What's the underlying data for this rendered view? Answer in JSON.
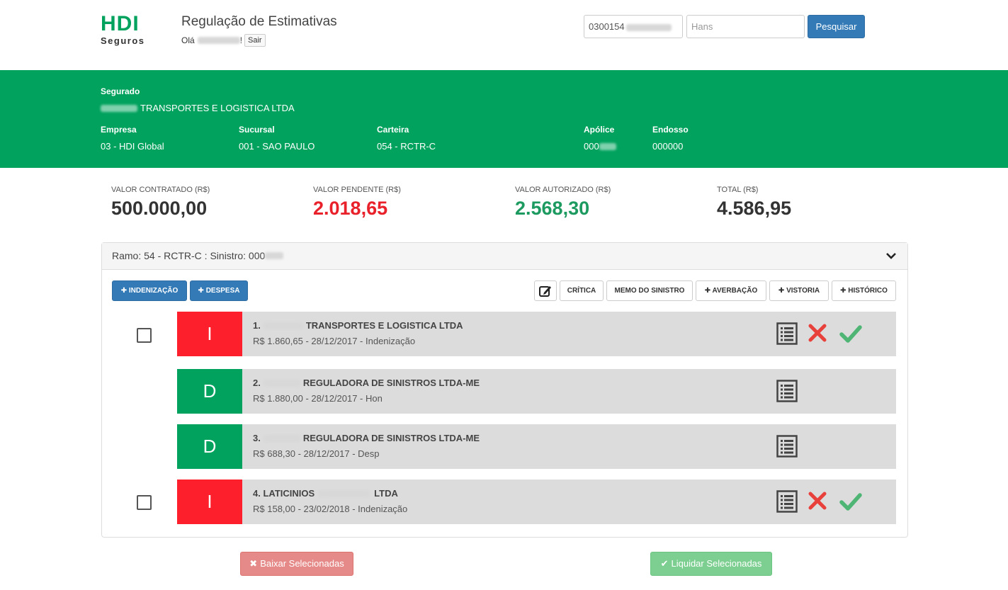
{
  "header": {
    "logo_text": "HDI",
    "logo_sub": "Seguros",
    "title": "Regulação de Estimativas",
    "greeting_prefix": "Olá",
    "greeting_suffix": "!",
    "logout_label": "Sair",
    "search_number": "0300154",
    "search_name_placeholder": "Hans",
    "search_button": "Pesquisar"
  },
  "insured": {
    "segurado_label": "Segurado",
    "segurado_value": "TRANSPORTES E LOGISTICA LTDA",
    "empresa_label": "Empresa",
    "empresa_value": "03 - HDI Global",
    "sucursal_label": "Sucursal",
    "sucursal_value": "001 - SAO PAULO",
    "carteira_label": "Carteira",
    "carteira_value": "054 - RCTR-C",
    "apolice_label": "Apólice",
    "apolice_value": "000",
    "endosso_label": "Endosso",
    "endosso_value": "000000"
  },
  "totals": {
    "contratado_label": "VALOR CONTRATADO (R$)",
    "contratado_value": "500.000,00",
    "pendente_label": "VALOR PENDENTE (R$)",
    "pendente_value": "2.018,65",
    "autorizado_label": "VALOR AUTORIZADO (R$)",
    "autorizado_value": "2.568,30",
    "total_label": "TOTAL (R$)",
    "total_value": "4.586,95"
  },
  "panel": {
    "title": "Ramo: 54 - RCTR-C : Sinistro: 000",
    "btn_indenizacao": "INDENIZAÇÃO",
    "btn_despesa": "DESPESA",
    "btn_critica": "CRÍTICA",
    "btn_memo": "MEMO DO SINISTRO",
    "btn_averbacao": "AVERBAÇÃO",
    "btn_vistoria": "VISTORIA",
    "btn_historico": "HISTÓRICO"
  },
  "rows": [
    {
      "letter": "I",
      "title_prefix": "1.",
      "title_suffix": "TRANSPORTES E LOGISTICA LTDA",
      "subtitle": "R$ 1.860,65 - 28/12/2017 - Indenização"
    },
    {
      "letter": "D",
      "title_prefix": "2.",
      "title_suffix": "REGULADORA DE SINISTROS LTDA-ME",
      "subtitle": "R$ 1.880,00 - 28/12/2017 - Hon"
    },
    {
      "letter": "D",
      "title_prefix": "3.",
      "title_suffix": "REGULADORA DE SINISTROS LTDA-ME",
      "subtitle": "R$ 688,30 - 28/12/2017 - Desp"
    },
    {
      "letter": "I",
      "title_prefix": "4. LATICINIOS",
      "title_suffix": "LTDA",
      "subtitle": "R$ 158,00 - 23/02/2018 - Indenização"
    }
  ],
  "footer": {
    "baixar": "Baixar Selecionadas",
    "liquidar": "Liquidar Selecionadas"
  },
  "colors": {
    "brand_green": "#00a25d",
    "danger_red": "#fd1f2b",
    "primary_blue": "#337ab7"
  }
}
